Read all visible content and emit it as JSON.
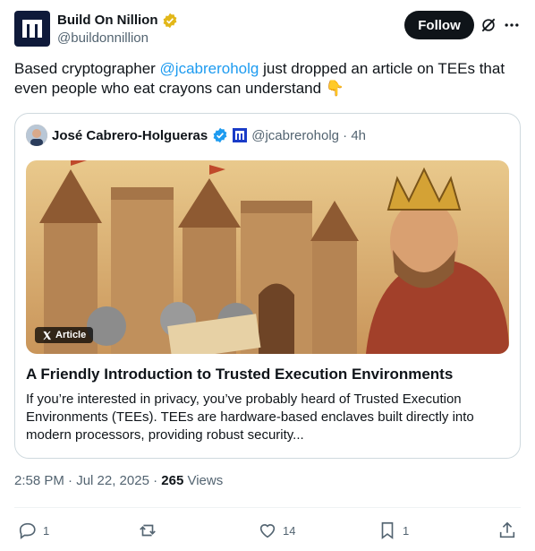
{
  "author": {
    "name": "Build On Nillion",
    "handle": "@buildonnillion"
  },
  "follow_label": "Follow",
  "tweet": {
    "text_before": "Based cryptographer ",
    "mention": "@jcabreroholg",
    "text_after": " just dropped an article on TEEs that even people who eat crayons can understand 👇"
  },
  "quote": {
    "author_name": "José Cabrero-Holgueras",
    "author_meta": "@jcabreroholg · 4h",
    "badge_label": "Article",
    "title": "A Friendly Introduction to Trusted Execution Environments",
    "description": "If you’re interested in privacy, you’ve probably heard of Trusted Execution Environments (TEEs). TEEs are hardware-based enclaves built directly into modern processors, providing robust security..."
  },
  "meta": {
    "timestamp": "2:58 PM · Jul 22, 2025 · ",
    "views_count": "265",
    "views_label": " Views"
  },
  "actions": {
    "replies": "1",
    "likes": "14",
    "bookmarks": "1"
  },
  "colors": {
    "link": "#1d9bf0",
    "verified_gold": "#e2b719",
    "verified_blue": "#1d9bf0"
  }
}
